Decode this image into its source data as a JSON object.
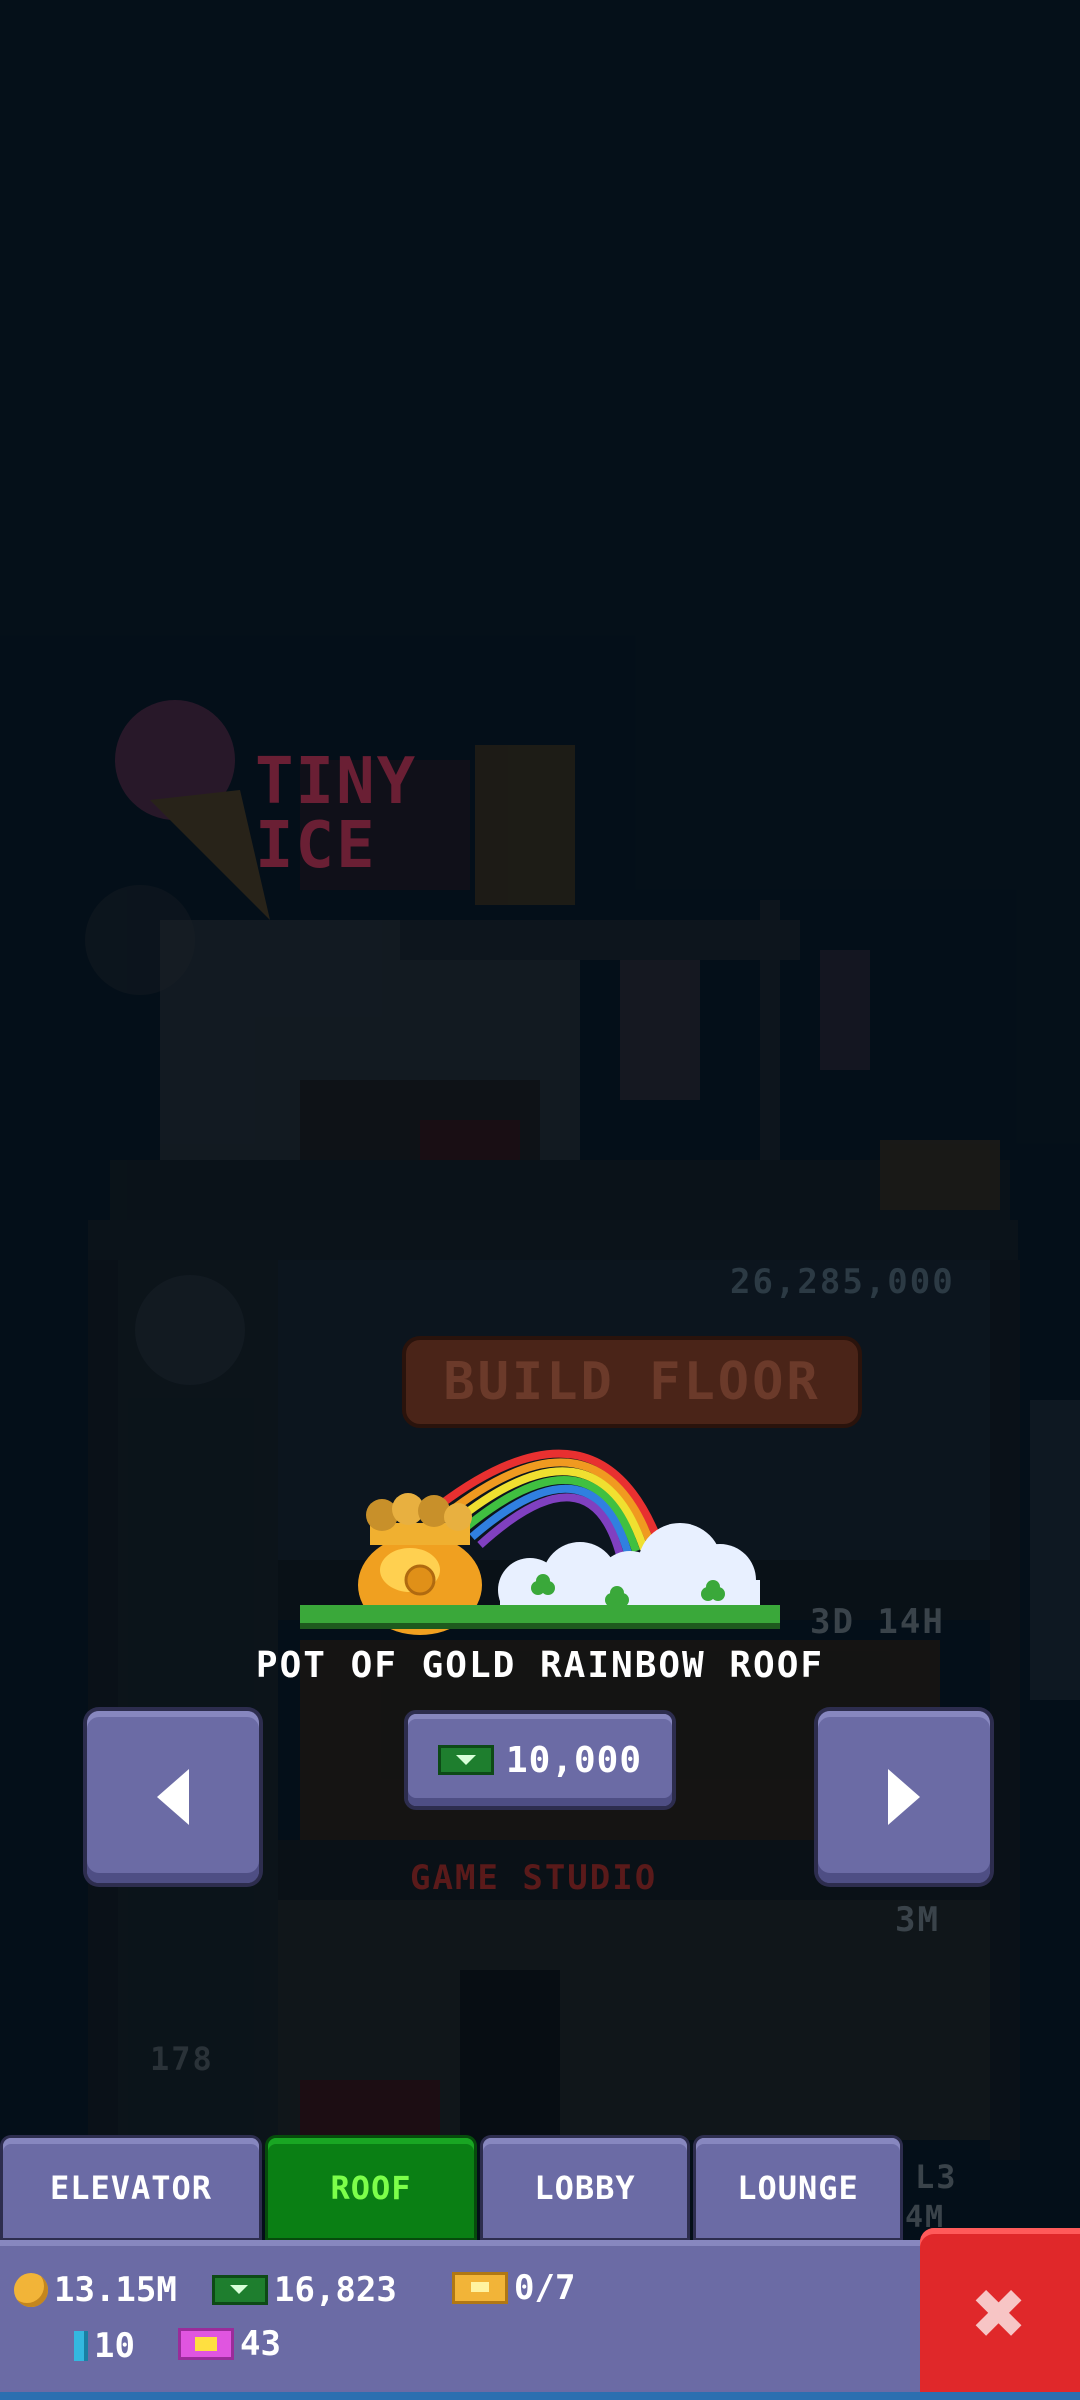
{
  "background_labels": {
    "building_value": "26,285,000",
    "build_floor": "BUILD FLOOR",
    "timer": "3D 14H",
    "floor_name": "GAME STUDIO",
    "floor_earn": "3M",
    "floor_number": "178",
    "side_level": "L3",
    "side_value": "4M",
    "sign_text": "TINY ICE"
  },
  "item": {
    "title": "POT OF GOLD RAINBOW ROOF",
    "price": "10,000"
  },
  "tabs": [
    {
      "label": "ELEVATOR"
    },
    {
      "label": "ROOF"
    },
    {
      "label": "LOBBY"
    },
    {
      "label": "LOUNGE"
    }
  ],
  "status": {
    "coins": "13.15M",
    "bux": "16,823",
    "tickets": "0/7",
    "keys": "10",
    "vip": "43"
  },
  "colors": {
    "button": "#6b6ba5",
    "active_tab": "#0a7f14",
    "close": "#e0282a",
    "background": "#06121c"
  }
}
